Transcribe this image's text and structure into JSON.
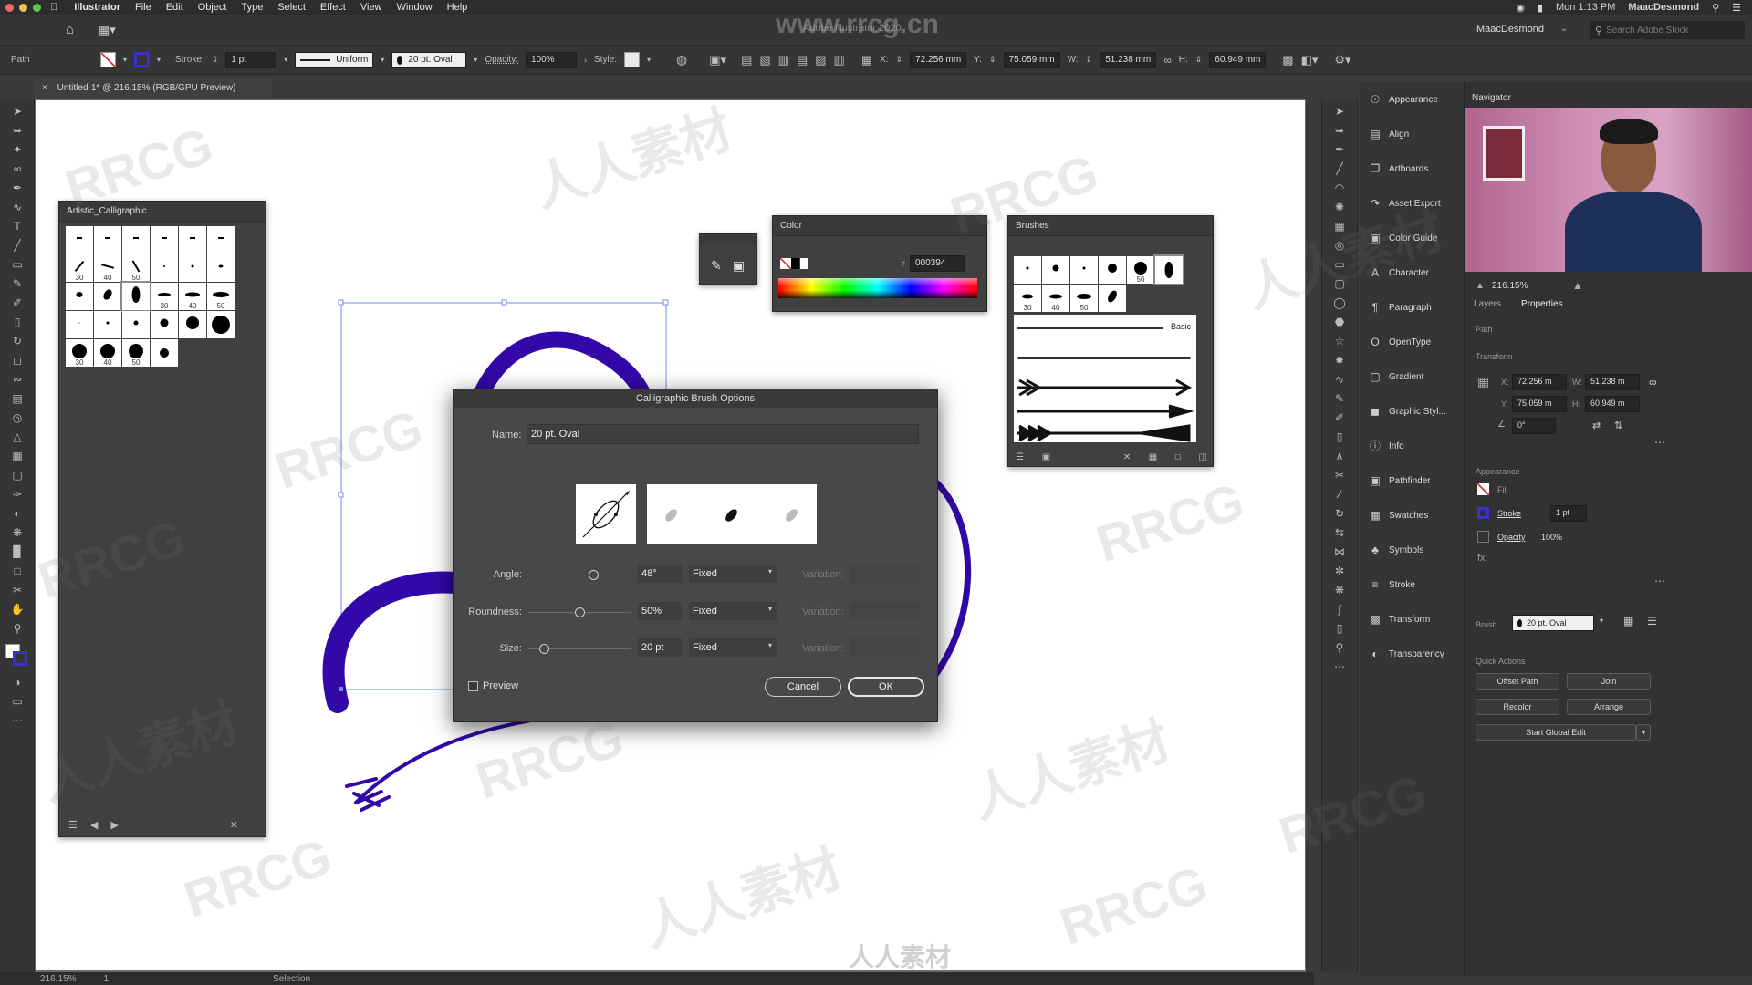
{
  "menubar": {
    "app": "Illustrator",
    "items": [
      "File",
      "Edit",
      "Object",
      "Type",
      "Select",
      "Effect",
      "View",
      "Window",
      "Help"
    ],
    "clock": "Mon 1:13 PM",
    "user": "MaacDesmond"
  },
  "appbar": {
    "window_title": "Adobe Illustrator 2020",
    "workspace_user": "MaacDesmond",
    "search_placeholder": "Search Adobe Stock"
  },
  "control": {
    "selection_type": "Path",
    "stroke_label": "Stroke:",
    "stroke_weight": "1 pt",
    "profile": "Uniform",
    "brush": "20 pt. Oval",
    "opacity_label": "Opacity:",
    "opacity": "100%",
    "style_label": "Style:",
    "x_label": "X:",
    "x": "72.256 mm",
    "y_label": "Y:",
    "y": "75.059 mm",
    "w_label": "W:",
    "w": "51.238 mm",
    "h_label": "H:",
    "h": "60.949 mm"
  },
  "document": {
    "tab": "Untitled-1* @ 216.15% (RGB/GPU Preview)"
  },
  "status": {
    "zoom": "216.15%",
    "artboard": "1",
    "tool": "Selection"
  },
  "calligraphic_panel": {
    "title": "Artistic_Calligraphic",
    "labels": [
      "30",
      "40",
      "50",
      "30",
      "40",
      "50",
      "30",
      "40",
      "50"
    ]
  },
  "color_panel": {
    "title": "Color",
    "hex": "000394"
  },
  "brushes_panel": {
    "title": "Brushes",
    "labels": [
      "50",
      "30",
      "40",
      "50"
    ],
    "basic": "Basic"
  },
  "dialog": {
    "title": "Calligraphic Brush Options",
    "name_label": "Name:",
    "name_value": "20 pt. Oval",
    "angle_label": "Angle:",
    "angle_value": "48°",
    "angle_mode": "Fixed",
    "roundness_label": "Roundness:",
    "roundness_value": "50%",
    "roundness_mode": "Fixed",
    "size_label": "Size:",
    "size_value": "20 pt",
    "size_mode": "Fixed",
    "variation_label": "Variation:",
    "preview_label": "Preview",
    "cancel": "Cancel",
    "ok": "OK",
    "angle_fraction": 0.63,
    "roundness_fraction": 0.5,
    "size_fraction": 0.15
  },
  "right_dock": {
    "items": [
      "Appearance",
      "Align",
      "Artboards",
      "Asset Export",
      "Color Guide",
      "Character",
      "Paragraph",
      "OpenType",
      "Gradient",
      "Graphic Styl...",
      "Info",
      "Pathfinder",
      "Swatches",
      "Symbols",
      "Stroke",
      "Transform",
      "Transparency"
    ]
  },
  "navigator": {
    "title": "Navigator",
    "zoom": "216.15%"
  },
  "properties": {
    "tab_layers": "Layers",
    "tab_properties": "Properties",
    "path": "Path",
    "transform": "Transform",
    "x_label": "X:",
    "x": "72.256 m",
    "w_label": "W:",
    "w": "51.238 m",
    "y_label": "Y:",
    "y": "75.059 m",
    "h_label": "H:",
    "h": "60.949 m",
    "angle": "0°",
    "appearance": "Appearance",
    "fill": "Fill",
    "stroke": "Stroke",
    "stroke_weight": "1 pt",
    "opacity": "Opacity",
    "opacity_value": "100%",
    "brush_label": "Brush",
    "brush_value": "20 pt. Oval",
    "quick_actions": "Quick Actions",
    "offset_path": "Offset Path",
    "join": "Join",
    "recolor": "Recolor",
    "arrange": "Arrange",
    "global_edit": "Start Global Edit"
  },
  "colors": {
    "stroke": "#3408a8",
    "accent": "#1473e6"
  },
  "watermarks": {
    "site": "www.rrcg.cn",
    "brand": "RRCG",
    "cn": "人人素材"
  }
}
